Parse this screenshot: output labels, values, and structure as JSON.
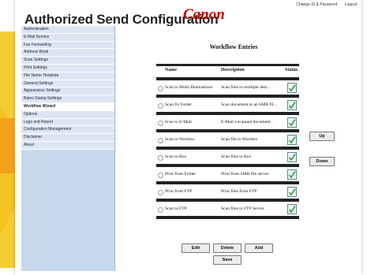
{
  "header": {
    "title": "Authorized Send Configuration",
    "brand": "Canon",
    "links": [
      "Change ID & Password",
      "Logout"
    ]
  },
  "sidebar": {
    "items": [
      {
        "label": "Authentication"
      },
      {
        "label": "E-Mail Service"
      },
      {
        "label": "Fax Forwarding"
      },
      {
        "label": "Address Book"
      },
      {
        "label": "Scan Settings"
      },
      {
        "label": "Print Settings"
      },
      {
        "label": "File Name Template"
      },
      {
        "label": "General Settings"
      },
      {
        "label": "Appearance Settings"
      },
      {
        "label": "Bates Stamp Settings"
      },
      {
        "label": "Workflow Wizard",
        "active": true
      },
      {
        "label": "Options"
      },
      {
        "label": "Logs and Report"
      },
      {
        "label": "Configuration Management"
      },
      {
        "label": "Disclaimer"
      },
      {
        "label": "About"
      }
    ]
  },
  "main": {
    "heading": "Workflow Entries",
    "columns": {
      "name": "Name",
      "description": "Description",
      "status": "Status"
    },
    "rows": [
      {
        "name": "Scan to Multi-Destinations",
        "description": "Scan files to multiple dest...",
        "status": "checked"
      },
      {
        "name": "Scan To Folder",
        "description": "Scan document to an SMB fil...",
        "status": "checked"
      },
      {
        "name": "Scan to E-Mail",
        "description": "E-Mail a scanned document.",
        "status": "checked"
      },
      {
        "name": "Scan to Worldox",
        "description": "Scan file to Worldox",
        "status": "checked"
      },
      {
        "name": "Scan to Box",
        "description": "Scan files to Box",
        "status": "checked"
      },
      {
        "name": "Print from Folder",
        "description": "Print from SMB file server.",
        "status": "checked"
      },
      {
        "name": "Print from FTP",
        "description": "Print files from FTP",
        "status": "checked"
      },
      {
        "name": "Scan to FTP",
        "description": "Scan files to FTP Server",
        "status": "checked"
      }
    ],
    "buttons": {
      "up": "Up",
      "down": "Down",
      "edit": "Edit",
      "delete": "Delete",
      "add": "Add",
      "save": "Save"
    }
  },
  "colors": {
    "brand": "#cc0000",
    "sidebar_bg": "#c8d8ec",
    "check": "#3a9a2a"
  }
}
